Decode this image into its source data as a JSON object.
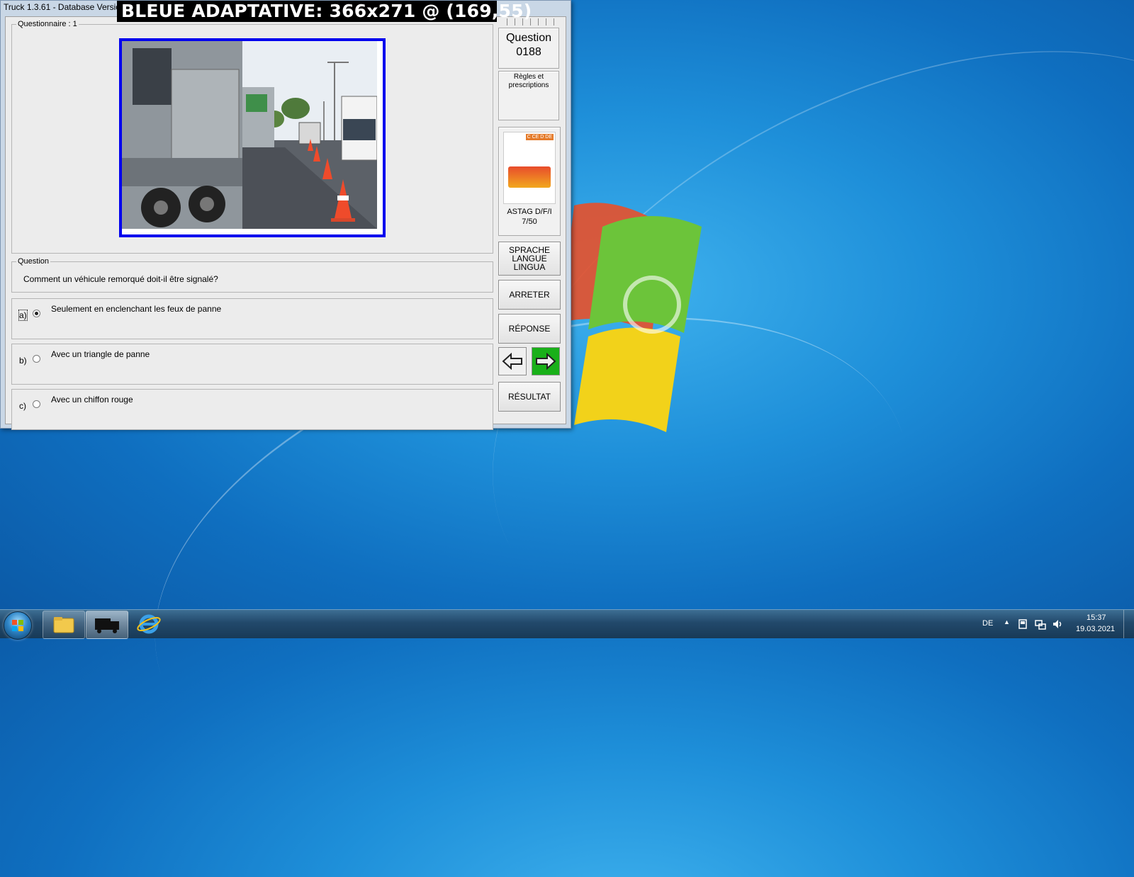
{
  "window": {
    "title": "Truck 1.3.61 - Database Version 2020.2"
  },
  "overlay": {
    "text": "BLEUE ADAPTATIVE: 366x271 @ (169,55)"
  },
  "questionnaire": {
    "legend": "Questionnaire : 1",
    "image_description": "trucks-roadside-cones"
  },
  "question": {
    "legend": "Question",
    "text": "Comment un véhicule remorqué doit-il être signalé?"
  },
  "answers": [
    {
      "letter": "a)",
      "text": "Seulement en enclenchant les feux de panne",
      "selected": true
    },
    {
      "letter": "b)",
      "text": "Avec un triangle de panne",
      "selected": false
    },
    {
      "letter": "c)",
      "text": "Avec un chiffon rouge",
      "selected": false
    }
  ],
  "side": {
    "question_label": "Question",
    "question_number": "0188",
    "category_line1": "Règles et",
    "category_line2": "prescriptions",
    "book_title": "ASTAG D/F/I",
    "book_page": "7/50",
    "book_badge": "C CE D DE",
    "language_line1": "SPRACHE",
    "language_line2": "LANGUE",
    "language_line3": "LINGUA",
    "stop_label": "ARRETER",
    "answer_label": "RÉPONSE",
    "result_label": "RÉSULTAT"
  },
  "taskbar": {
    "language": "DE",
    "time": "15:37",
    "date": "19.03.2021"
  },
  "colors": {
    "image_border": "#0000ee",
    "next_button": "#19b019"
  }
}
